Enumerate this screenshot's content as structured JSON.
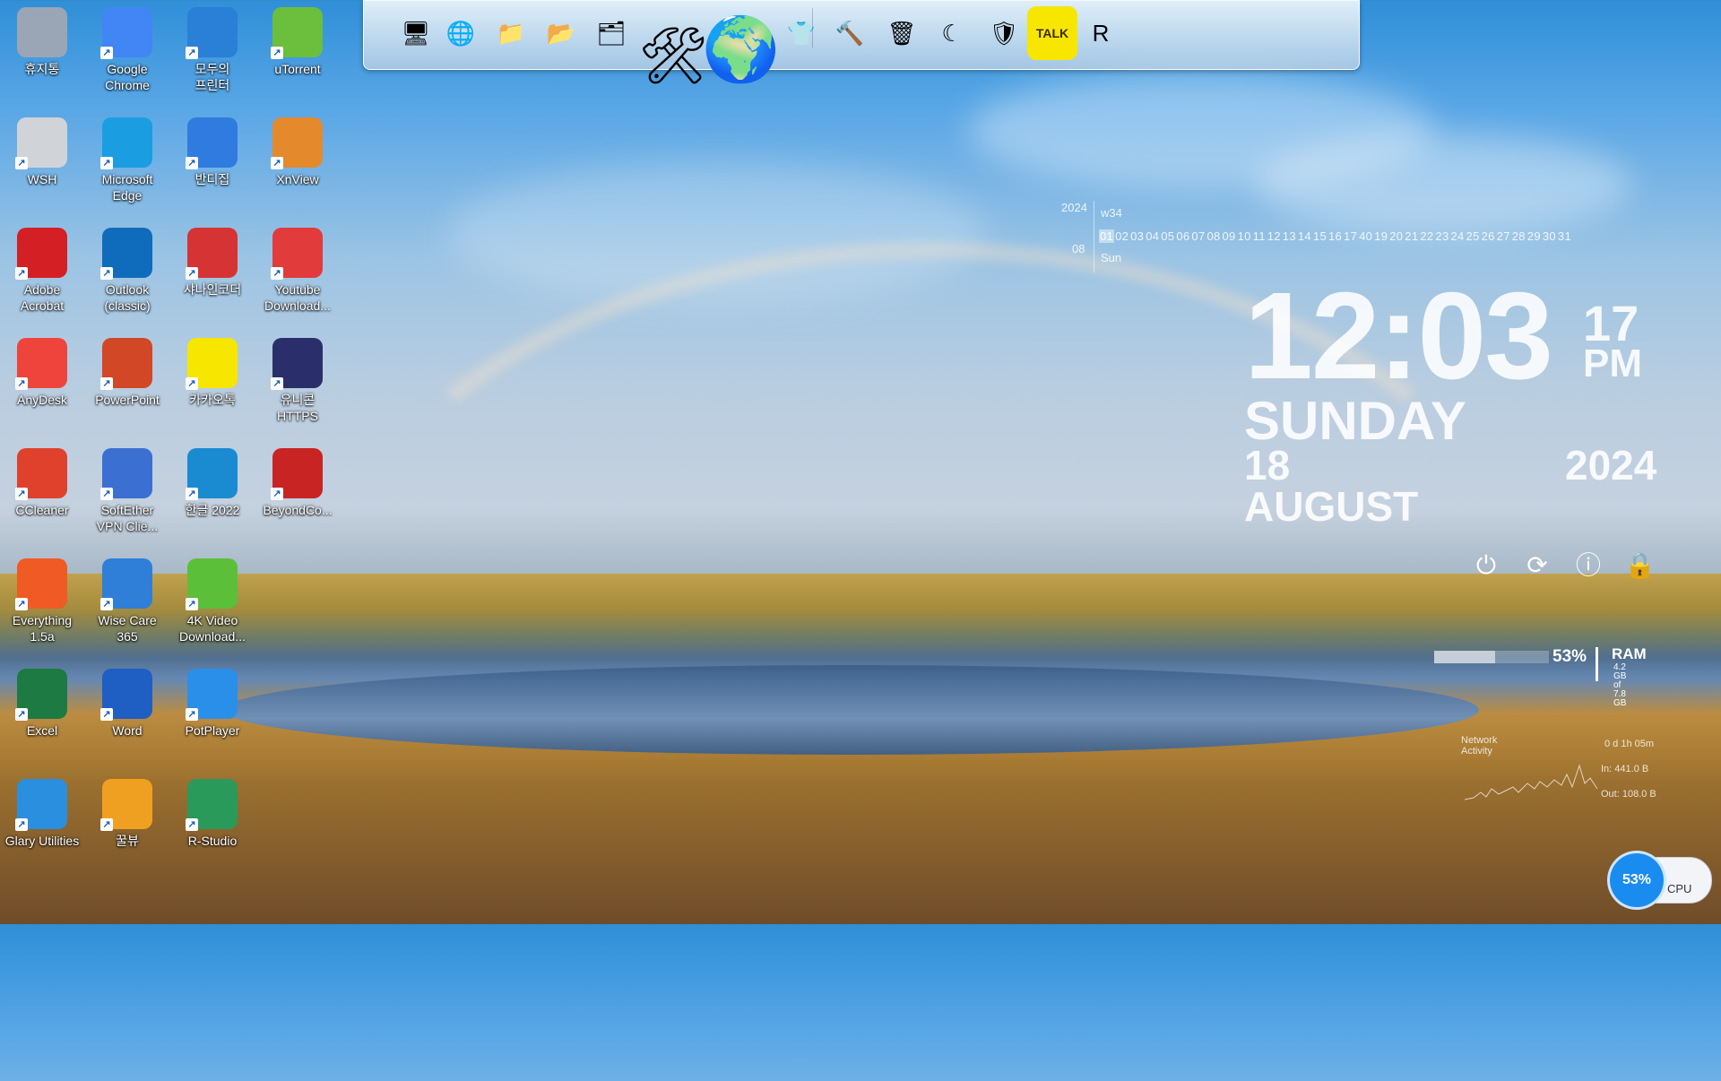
{
  "desktop_icons": [
    {
      "label": "휴지통",
      "icon": "recycle-bin-icon",
      "color": "#9aa6b5"
    },
    {
      "label": "Google\nChrome",
      "icon": "chrome-icon",
      "color": "#4285f4"
    },
    {
      "label": "모두의\n프린터",
      "icon": "printer-icon",
      "color": "#2a7fd6"
    },
    {
      "label": "uTorrent",
      "icon": "utorrent-icon",
      "color": "#6bbf3c"
    },
    {
      "label": "WSH",
      "icon": "wsh-icon",
      "color": "#d0d4d8"
    },
    {
      "label": "Microsoft\nEdge",
      "icon": "edge-icon",
      "color": "#1b9de2"
    },
    {
      "label": "반디집",
      "icon": "bandizip-icon",
      "color": "#2f7be0"
    },
    {
      "label": "XnView",
      "icon": "xnview-icon",
      "color": "#e48a2c"
    },
    {
      "label": "Adobe\nAcrobat",
      "icon": "acrobat-icon",
      "color": "#d41f24"
    },
    {
      "label": "Outlook\n(classic)",
      "icon": "outlook-icon",
      "color": "#0f6cbd"
    },
    {
      "label": "샤나인코더",
      "icon": "shana-encoder-icon",
      "color": "#d63434"
    },
    {
      "label": "Youtube\nDownload...",
      "icon": "youtube-downloader-icon",
      "color": "#e23b3b"
    },
    {
      "label": "AnyDesk",
      "icon": "anydesk-icon",
      "color": "#ef443b"
    },
    {
      "label": "PowerPoint",
      "icon": "powerpoint-icon",
      "color": "#d24726"
    },
    {
      "label": "카카오톡",
      "icon": "kakaotalk-icon",
      "color": "#f7e600"
    },
    {
      "label": "유니콘\nHTTPS",
      "icon": "unicorn-https-icon",
      "color": "#2a2f6b"
    },
    {
      "label": "CCleaner",
      "icon": "ccleaner-icon",
      "color": "#e0412c"
    },
    {
      "label": "SoftEther\nVPN Clie...",
      "icon": "softether-icon",
      "color": "#3b6fd1"
    },
    {
      "label": "한글 2022",
      "icon": "hangul-icon",
      "color": "#1a8bd1"
    },
    {
      "label": "BeyondCo...",
      "icon": "beyondcompare-icon",
      "color": "#c82424"
    },
    {
      "label": "Everything\n1.5a",
      "icon": "everything-icon",
      "color": "#f05a24"
    },
    {
      "label": "Wise Care\n365",
      "icon": "wisecare-icon",
      "color": "#2f7fd8"
    },
    {
      "label": "4K Video\nDownload...",
      "icon": "4k-video-downloader-icon",
      "color": "#5bbf3a"
    },
    {
      "label": "",
      "icon": "",
      "color": ""
    },
    {
      "label": "Excel",
      "icon": "excel-icon",
      "color": "#1d7a43"
    },
    {
      "label": "Word",
      "icon": "word-icon",
      "color": "#1f5fc4"
    },
    {
      "label": "PotPlayer",
      "icon": "potplayer-icon",
      "color": "#2a8fe8"
    },
    {
      "label": "",
      "icon": "",
      "color": ""
    },
    {
      "label": "Glary Utilities",
      "icon": "glary-utilities-icon",
      "color": "#2b8fe0"
    },
    {
      "label": "꿀뷰",
      "icon": "honeyview-icon",
      "color": "#f0a020"
    },
    {
      "label": "R-Studio",
      "icon": "r-studio-icon",
      "color": "#2a9a5a"
    }
  ],
  "dock_items": [
    {
      "icon": "monitor-dock-icon",
      "glyph": "🖥"
    },
    {
      "icon": "network-globe-dock-icon",
      "glyph": "🌐"
    },
    {
      "icon": "folder-dock-icon",
      "glyph": "📁"
    },
    {
      "icon": "green-folder-dock-icon",
      "glyph": "📂"
    },
    {
      "icon": "drive-folder-dock-icon",
      "glyph": "🗂"
    },
    {
      "icon": "tools-dock-icon",
      "glyph": "🛠"
    },
    {
      "icon": "globe-dock-icon",
      "glyph": "🌍"
    },
    {
      "icon": "tshirt-dock-icon",
      "glyph": "👕"
    },
    {
      "icon": "hammer-dock-icon",
      "glyph": "🔨"
    },
    {
      "icon": "trash-dock-icon",
      "glyph": "🗑"
    },
    {
      "icon": "glary-dock-icon",
      "glyph": "☾"
    },
    {
      "icon": "wise-shield-dock-icon",
      "glyph": "🛡"
    },
    {
      "icon": "kakaotalk-dock-icon",
      "glyph": "TALK"
    },
    {
      "icon": "r-studio-dock-icon",
      "glyph": "R"
    }
  ],
  "calendar": {
    "year": "2024",
    "week": "w34",
    "month": "08",
    "days": [
      "01",
      "02",
      "03",
      "04",
      "05",
      "06",
      "07",
      "08",
      "09",
      "10",
      "11",
      "12",
      "13",
      "14",
      "15",
      "16",
      "17",
      "40",
      "19",
      "20",
      "21",
      "22",
      "23",
      "24",
      "25",
      "26",
      "27",
      "28",
      "29",
      "30",
      "31"
    ],
    "today_index": 0,
    "dow": "Sun"
  },
  "clock": {
    "time": "12:03",
    "seconds": "17",
    "ampm": "PM",
    "day": "SUNDAY",
    "date": "18 AUGUST",
    "year": "2024"
  },
  "power_buttons": [
    {
      "name": "power-icon",
      "glyph": "⏻"
    },
    {
      "name": "restart-icon",
      "glyph": "⟳"
    },
    {
      "name": "info-icon",
      "glyph": "ⓘ"
    },
    {
      "name": "lock-icon",
      "glyph": "🔒"
    }
  ],
  "ram": {
    "percent": "53%",
    "fill_fraction": 0.53,
    "label": "RAM",
    "used": "4.2 GB",
    "total": "of 7.8 GB"
  },
  "network": {
    "title": "Network Activity",
    "uptime": "0 d 1h 05m",
    "in": "In: 441.0 B",
    "out": "Out: 108.0 B"
  },
  "cpu": {
    "percent": "53%",
    "label": "CPU"
  }
}
